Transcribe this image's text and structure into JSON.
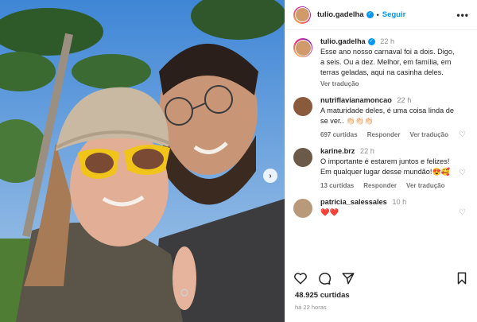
{
  "post": {
    "username": "tulio.gadelha",
    "follow_label": "Seguir",
    "more_label": "•••",
    "likes": "48.925 curtidas",
    "time_ago": "há 22 horas"
  },
  "caption": {
    "username": "tulio.gadelha",
    "time": "22 h",
    "text": "Esse ano nosso carnaval foi a dois. Digo, a seis. Ou a dez. Melhor, em família, em terras geladas, aqui na casinha deles.",
    "translate": "Ver tradução"
  },
  "comments": [
    {
      "username": "nutriflavianamoncao",
      "time": "22 h",
      "text": "A maturidade deles, é uma coisa linda de se ver.. 👏🏻👏🏻👏🏻",
      "likes": "697 curtidas",
      "reply": "Responder",
      "translate": "Ver tradução"
    },
    {
      "username": "karine.brz",
      "time": "22 h",
      "text": "O importante é estarem juntos e felizes! Em qualquer lugar desse mundão!😍🥰",
      "likes": "13 curtidas",
      "reply": "Responder",
      "translate": "Ver tradução"
    },
    {
      "username": "patricia_salessales",
      "time": "10 h",
      "text": "❤️❤️"
    }
  ],
  "icons": {
    "heart": "heart-icon",
    "comment": "comment-icon",
    "share": "share-icon",
    "save": "bookmark-icon",
    "verified": "verified-icon",
    "next": "chevron-right-icon"
  },
  "colors": {
    "link": "#0095f6",
    "muted": "#737373",
    "text": "#262626"
  }
}
